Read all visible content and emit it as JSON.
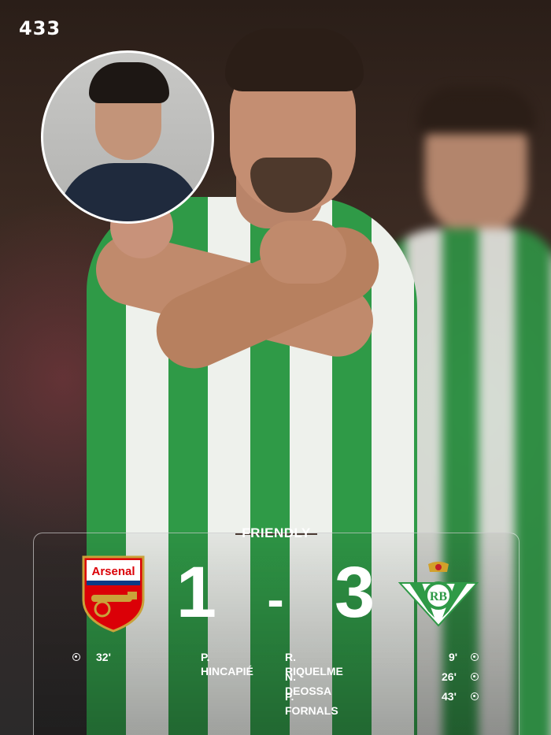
{
  "brand": {
    "logo_text": "433"
  },
  "match": {
    "competition": "FRIENDLY",
    "home": {
      "name": "Arsenal",
      "score": "1"
    },
    "separator": "-",
    "away": {
      "name": "Real Betis",
      "score": "3"
    },
    "home_scorers": [
      {
        "minute": "32'",
        "player": "P. HINCAPIÉ"
      }
    ],
    "away_scorers": [
      {
        "player": "R. RIQUELME",
        "minute": "9'"
      },
      {
        "player": "N. DEOSSA",
        "minute": "26'"
      },
      {
        "player": "P. FORNALS",
        "minute": "43'"
      }
    ]
  },
  "colors": {
    "betis_green": "#2f9a47",
    "arsenal_red": "#db0007",
    "text": "#ffffff"
  },
  "icons": [
    "football-icon",
    "arsenal-crest",
    "real-betis-crest"
  ]
}
